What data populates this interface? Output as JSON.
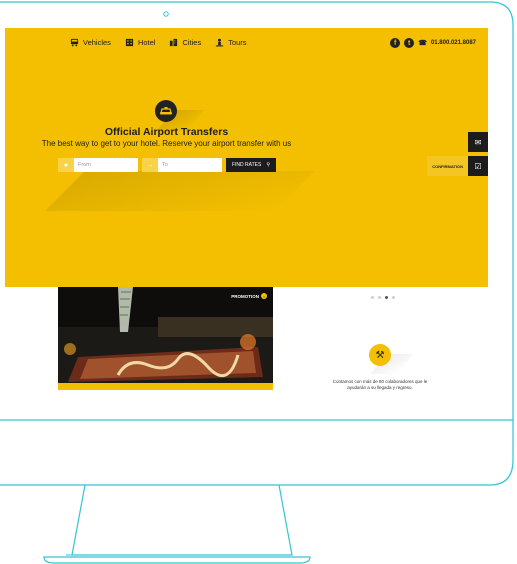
{
  "nav": {
    "items": [
      {
        "label": "Vehicles",
        "icon": "bus-icon"
      },
      {
        "label": "Hotel",
        "icon": "building-icon"
      },
      {
        "label": "Cities",
        "icon": "city-icon"
      },
      {
        "label": "Tours",
        "icon": "person-icon"
      }
    ],
    "phone": "01.800.021.8087",
    "social": [
      "facebook-icon",
      "twitter-icon"
    ]
  },
  "hero": {
    "title": "Official Airport Transfers",
    "subtitle": "The best way to get to your hotel. Reserve your airport transfer with us",
    "logo_icon": "taxi-icon"
  },
  "search": {
    "from_placeholder": "From",
    "to_placeholder": "To",
    "button_label": "FIND RATES"
  },
  "side": {
    "confirmation_label": "CONFIRMATION"
  },
  "promo": {
    "badge": "PROMOTION"
  },
  "staff": {
    "text": "Contamos con más de 80 colaboradores que le ayudarán a su llegada y regreso."
  },
  "colors": {
    "accent": "#f3bf00",
    "dark": "#1c1c1c",
    "frame": "#35c3d4"
  }
}
